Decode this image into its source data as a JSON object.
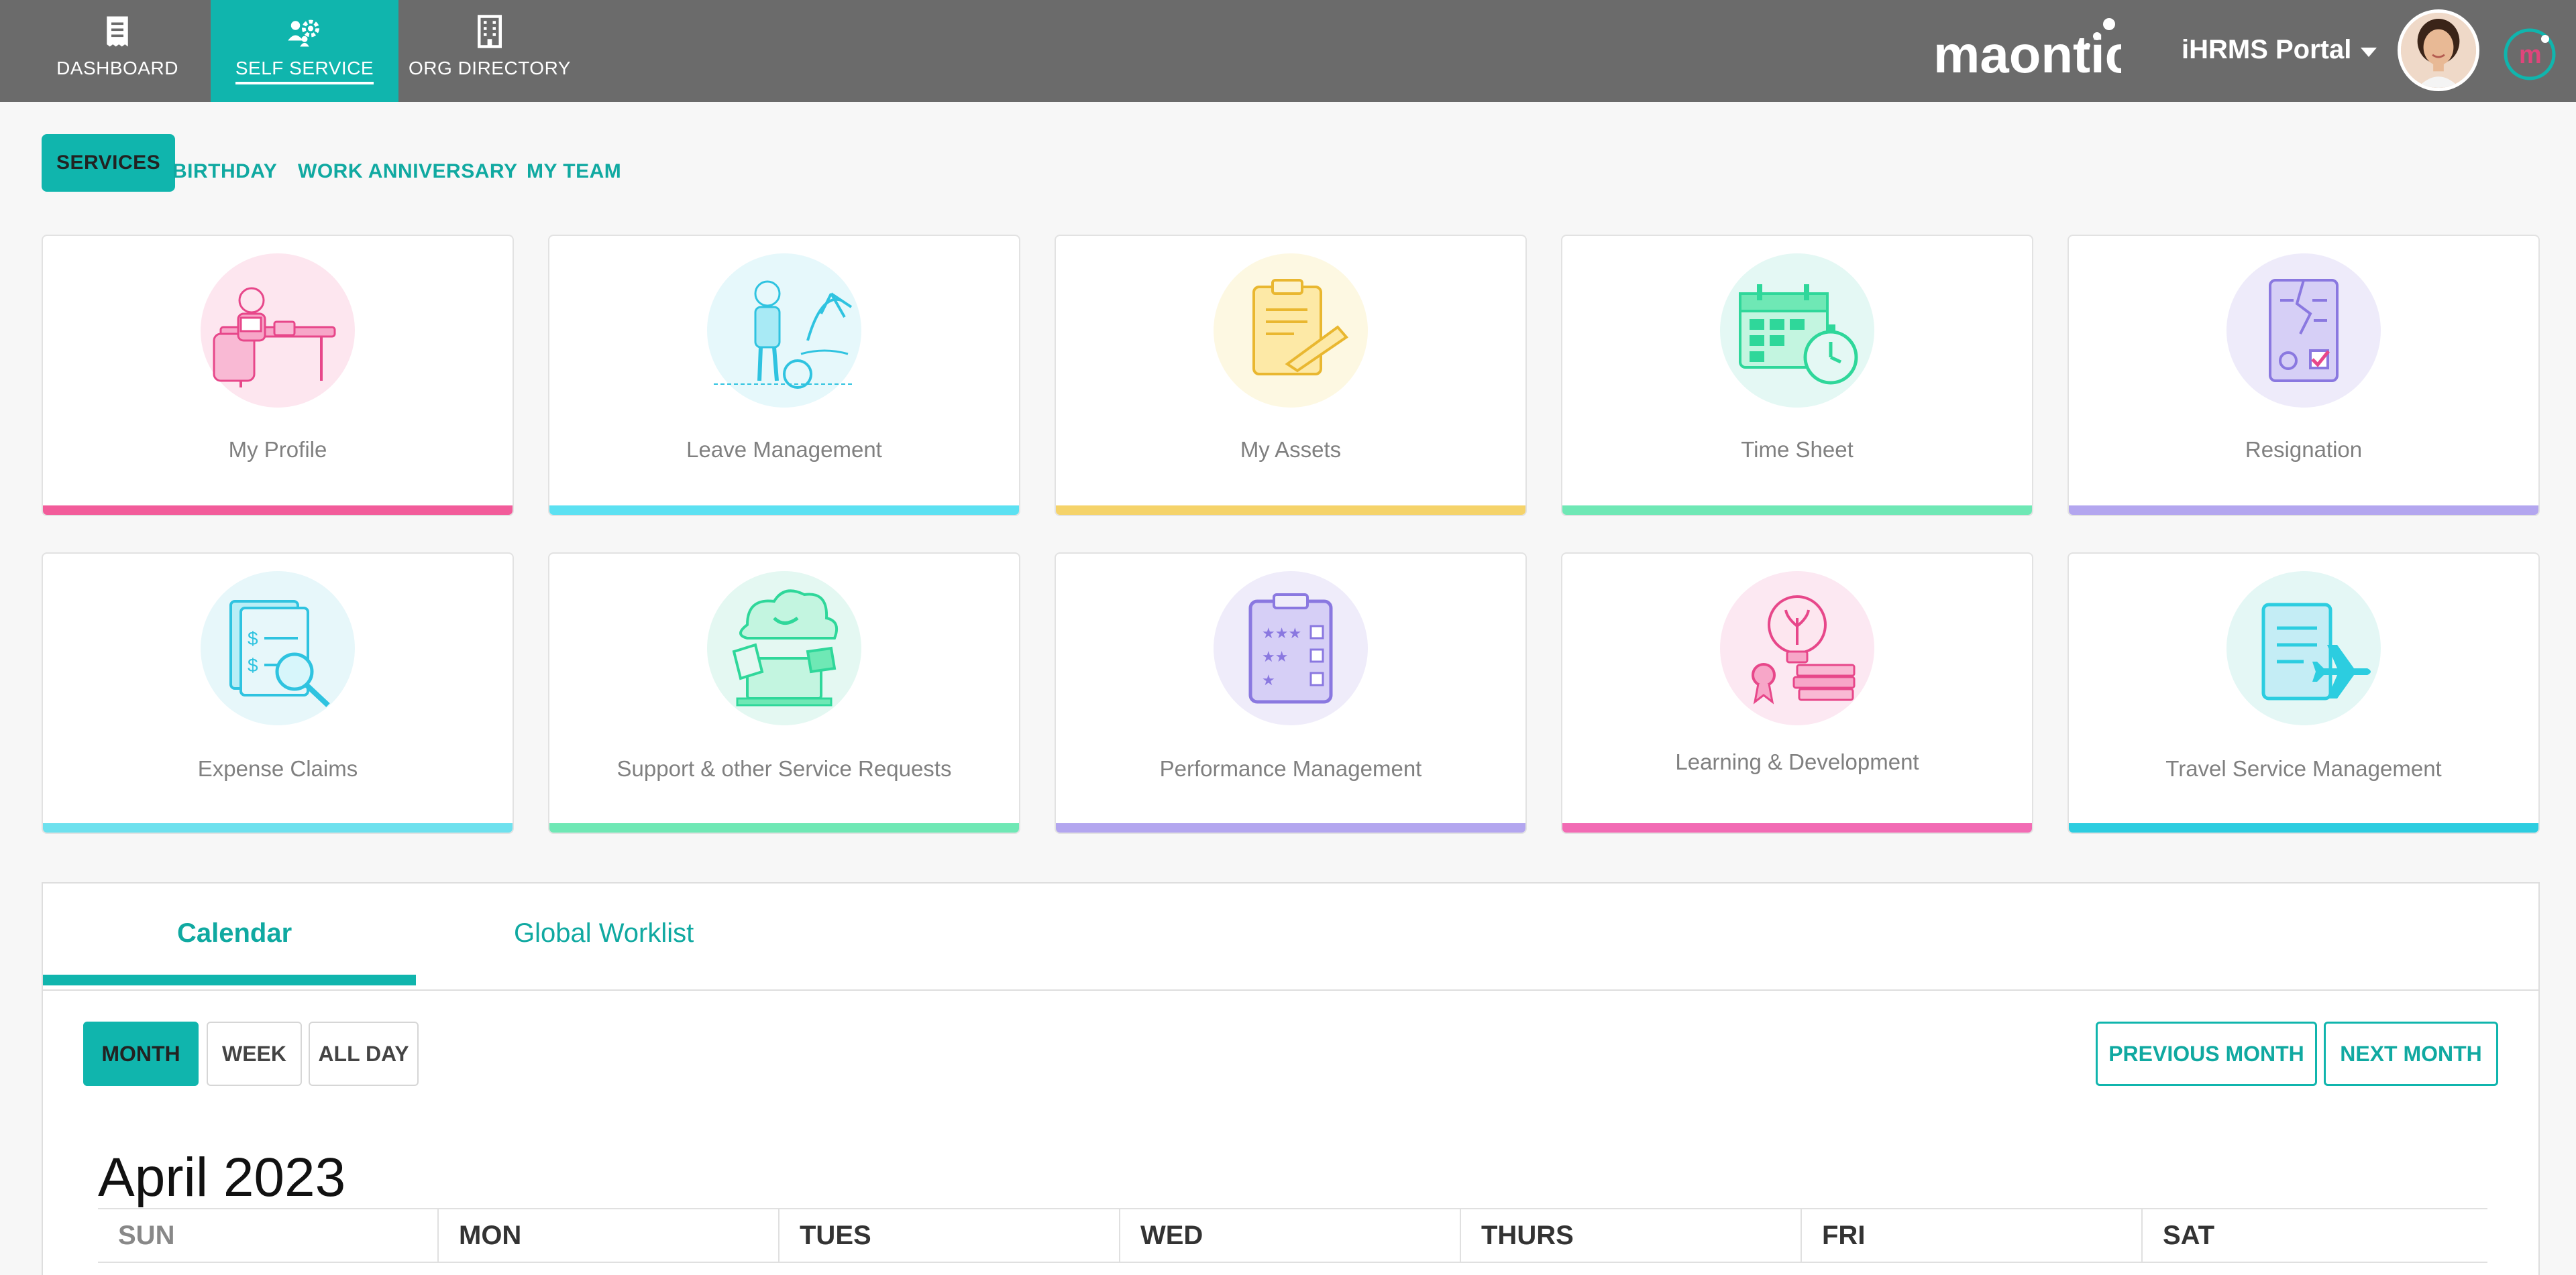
{
  "nav": {
    "tabs": [
      {
        "label": "DASHBOARD",
        "icon": "receipt-icon"
      },
      {
        "label": "SELF SERVICE",
        "icon": "people-gear-icon"
      },
      {
        "label": "ORG DIRECTORY",
        "icon": "building-icon"
      }
    ],
    "active": "SELF SERVICE",
    "brand": "maontic",
    "portal_label": "iHRMS Portal"
  },
  "subtabs": [
    "SERVICES",
    "BIRTHDAY",
    "WORK ANNIVERSARY",
    "MY TEAM"
  ],
  "cards": [
    {
      "title": "My Profile",
      "accent": "#f25c9a",
      "tint": "#fde6ef"
    },
    {
      "title": "Leave Management",
      "accent": "#5ce1f2",
      "tint": "#e6f8fb"
    },
    {
      "title": "My Assets",
      "accent": "#f5d36a",
      "tint": "#fdf8e2"
    },
    {
      "title": "Time Sheet",
      "accent": "#6fe8b5",
      "tint": "#e4f8f4"
    },
    {
      "title": "Resignation",
      "accent": "#b3a6ef",
      "tint": "#eeebfa"
    },
    {
      "title": "Expense Claims",
      "accent": "#6ee1ee",
      "tint": "#e7f7fa"
    },
    {
      "title": "Support & other Service Requests",
      "accent": "#6fe8b5",
      "tint": "#e4f8f2"
    },
    {
      "title": "Performance Management",
      "accent": "#b3a6ef",
      "tint": "#efecfa"
    },
    {
      "title": "Learning & Development",
      "accent": "#f26bb4",
      "tint": "#fce8f2"
    },
    {
      "title": "Travel Service Management",
      "accent": "#2ccde0",
      "tint": "#e4f7f5"
    }
  ],
  "panel": {
    "tabs": [
      "Calendar",
      "Global Worklist"
    ],
    "view_buttons": [
      "MONTH",
      "WEEK",
      "ALL DAY"
    ],
    "prev_label": "PREVIOUS MONTH",
    "next_label": "NEXT MONTH",
    "month_title": "April 2023",
    "weekdays": [
      "SUN",
      "MON",
      "TUES",
      "WED",
      "THURS",
      "FRI",
      "SAT"
    ]
  },
  "colors": {
    "topbar": "#6b6b6b",
    "accent": "#10b5ad"
  }
}
